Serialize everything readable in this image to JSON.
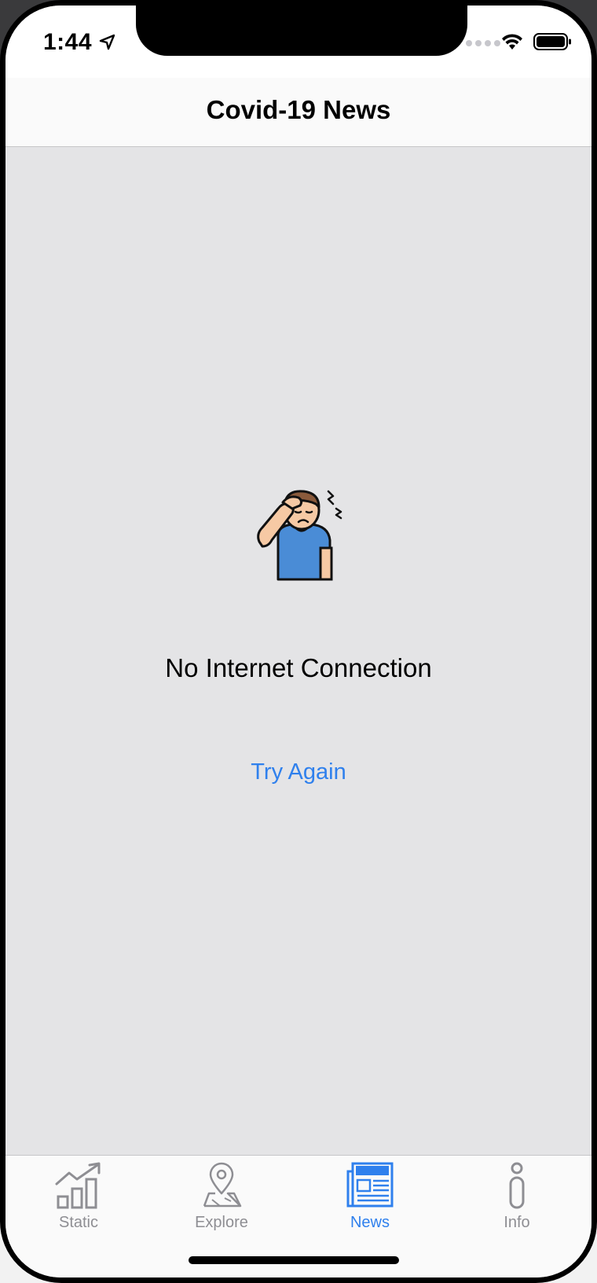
{
  "status_bar": {
    "time": "1:44"
  },
  "nav": {
    "title": "Covid-19 News"
  },
  "empty_state": {
    "message": "No Internet Connection",
    "retry_label": "Try Again"
  },
  "tabs": [
    {
      "label": "Static",
      "icon": "chart-up-icon",
      "active": false
    },
    {
      "label": "Explore",
      "icon": "map-pin-icon",
      "active": false
    },
    {
      "label": "News",
      "icon": "newspaper-icon",
      "active": true
    },
    {
      "label": "Info",
      "icon": "info-icon",
      "active": false
    }
  ],
  "colors": {
    "accent": "#2f80ed",
    "inactive": "#8e8e93",
    "content_bg": "#e4e4e6",
    "shirt": "#4a8cd6"
  }
}
